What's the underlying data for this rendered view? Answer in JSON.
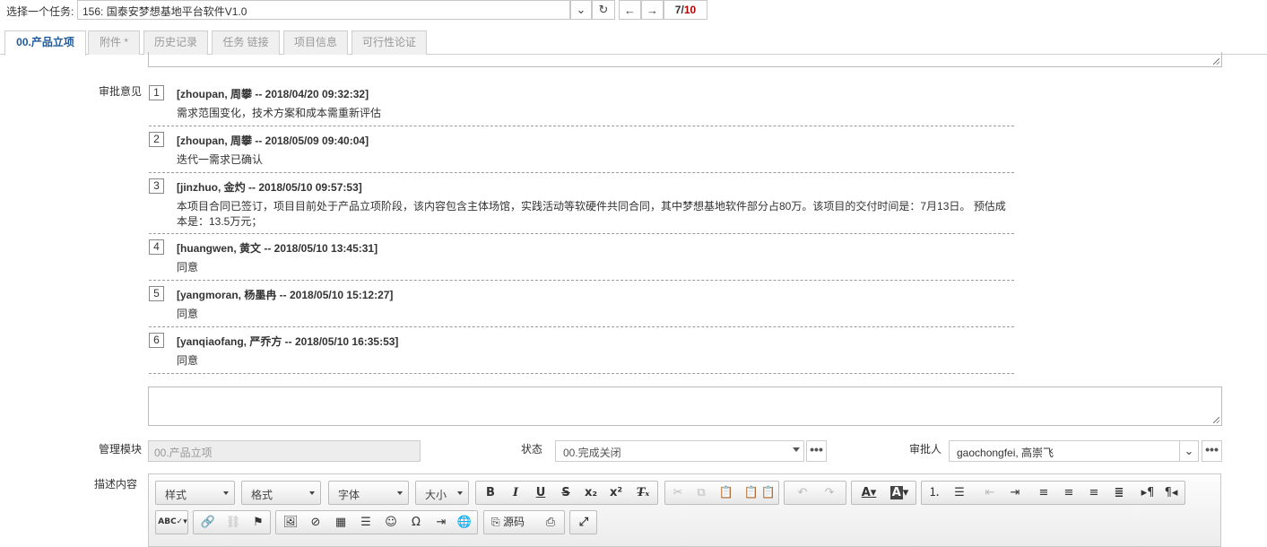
{
  "top": {
    "task_label": "选择一个任务:",
    "task_value": "156: 国泰安梦想基地平台软件V1.0",
    "pager_current": "7",
    "pager_sep": "/",
    "pager_total": "10"
  },
  "tabs": [
    "00.产品立项",
    "附件 *",
    "历史记录",
    "任务 链接",
    "项目信息",
    "可行性论证"
  ],
  "labels": {
    "review": "审批意见",
    "module": "管理模块",
    "status": "状态",
    "approver": "审批人",
    "description": "描述内容"
  },
  "reviews": [
    {
      "num": "1",
      "head": "[zhoupan, 周攀 -- 2018/04/20 09:32:32]",
      "body": "需求范围变化，技术方案和成本需重新评估"
    },
    {
      "num": "2",
      "head": "[zhoupan, 周攀 -- 2018/05/09 09:40:04]",
      "body": "迭代一需求已确认"
    },
    {
      "num": "3",
      "head": "[jinzhuo, 金灼 -- 2018/05/10 09:57:53]",
      "body": "本项目合同已签订，项目目前处于产品立项阶段，该内容包含主体场馆，实践活动等软硬件共同合同，其中梦想基地软件部分占80万。该项目的交付时间是：7月13日。 预估成本是：13.5万元；"
    },
    {
      "num": "4",
      "head": "[huangwen, 黄文 -- 2018/05/10 13:45:31]",
      "body": "同意"
    },
    {
      "num": "5",
      "head": "[yangmoran, 杨墨冉 -- 2018/05/10 15:12:27]",
      "body": "同意"
    },
    {
      "num": "6",
      "head": "[yanqiaofang, 严乔方 -- 2018/05/10 16:35:53]",
      "body": "同意"
    }
  ],
  "form": {
    "module_value": "00.产品立项",
    "status_value": "00.完成关闭",
    "approver_value": "gaochongfei, 高崇飞",
    "more": "•••"
  },
  "editor": {
    "style": "样式",
    "format": "格式",
    "font": "字体",
    "size": "大小",
    "source": "源码"
  }
}
